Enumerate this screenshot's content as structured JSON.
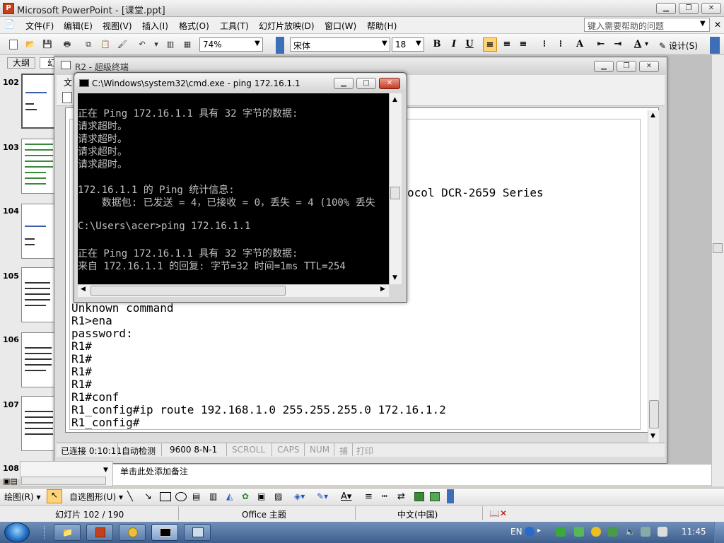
{
  "powerpoint": {
    "title": "Microsoft PowerPoint - [课堂.ppt]",
    "menu": [
      "文件(F)",
      "编辑(E)",
      "视图(V)",
      "插入(I)",
      "格式(O)",
      "工具(T)",
      "幻灯片放映(D)",
      "窗口(W)",
      "帮助(H)"
    ],
    "help_placeholder": "键入需要帮助的问题",
    "toolbar": {
      "zoom": "74%",
      "font_name": "宋体",
      "font_size": "18",
      "bold": "B",
      "italic": "I",
      "underline": "U",
      "design_label": "设计(S)"
    },
    "left_tabs": {
      "outline": "大纲",
      "slides": "幻"
    },
    "slide_numbers": [
      "102",
      "103",
      "104",
      "105",
      "106",
      "107",
      "108"
    ],
    "notes_placeholder": "单击此处添加备注",
    "draw_toolbar": {
      "draw_label": "绘图(R)",
      "autoshapes_label": "自选图形(U)"
    },
    "status": {
      "slide_info": "幻灯片 102 / 190",
      "theme": "Office 主题",
      "language": "中文(中国)"
    }
  },
  "terminal": {
    "title": "R2 - 超级终端",
    "menu_partial": "文",
    "partial_line": "ocol DCR-2659 Series",
    "lines": [
      "Unknown command",
      "R1>ena",
      "password:",
      "R1#",
      "R1#",
      "R1#",
      "R1#",
      "R1#conf",
      "R1_config#ip route 192.168.1.0 255.255.255.0 172.16.1.2",
      "R1_config#"
    ],
    "status": {
      "connected": "已连接 0:10:11",
      "detect": "自动检测",
      "baud": "9600 8-N-1",
      "scroll": "SCROLL",
      "caps": "CAPS",
      "num": "NUM",
      "capture": "捕",
      "print": "打印"
    }
  },
  "cmd": {
    "title": "C:\\Windows\\system32\\cmd.exe - ping  172.16.1.1",
    "lines": [
      "正在 Ping 172.16.1.1 具有 32 字节的数据:",
      "请求超时。",
      "请求超时。",
      "请求超时。",
      "请求超时。",
      "",
      "172.16.1.1 的 Ping 统计信息:",
      "    数据包: 已发送 = 4，已接收 = 0，丢失 = 4 (100% 丢失",
      "",
      "C:\\Users\\acer>ping 172.16.1.1",
      "",
      "正在 Ping 172.16.1.1 具有 32 字节的数据:",
      "来自 172.16.1.1 的回复: 字节=32 时间=1ms TTL=254"
    ]
  },
  "taskbar": {
    "lang": "EN",
    "clock": "11:45"
  },
  "colors": {
    "cmd_bg": "#000000",
    "cmd_fg": "#c0c0c0",
    "taskbar": "#3d5f8e",
    "highlight": "#ffd37a"
  }
}
